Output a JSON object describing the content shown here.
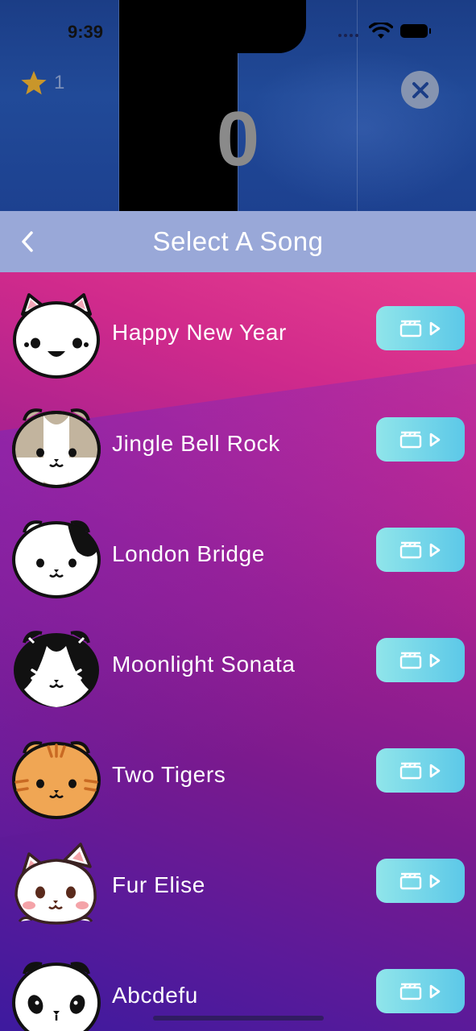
{
  "status_bar": {
    "time": "9:39"
  },
  "game": {
    "star_count": "1",
    "score": "0"
  },
  "header": {
    "title": "Select A Song"
  },
  "songs": [
    {
      "title": "Happy New Year",
      "avatar_icon": "white-cat-pink-ears-icon"
    },
    {
      "title": "Jingle Bell Rock",
      "avatar_icon": "tan-white-cat-icon"
    },
    {
      "title": "London Bridge",
      "avatar_icon": "white-cat-black-patch-icon"
    },
    {
      "title": "Moonlight Sonata",
      "avatar_icon": "tuxedo-cat-icon"
    },
    {
      "title": "Two Tigers",
      "avatar_icon": "orange-tabby-cat-icon"
    },
    {
      "title": "Fur Elise",
      "avatar_icon": "white-cat-blush-icon"
    },
    {
      "title": "Abcdefu",
      "avatar_icon": "panda-cat-icon"
    }
  ],
  "colors": {
    "header_bg": "#99a8d8",
    "button_gradient_start": "#90e5ea",
    "button_gradient_end": "#5cc8e8",
    "score_text": "#8a8a8a",
    "star": "#c9962a"
  }
}
